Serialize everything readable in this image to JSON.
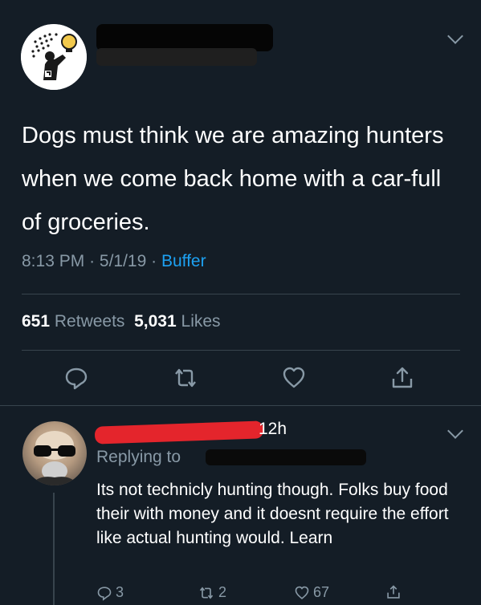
{
  "tweet": {
    "text": "Dogs must think we are amazing hunters when we come back home with a car-full of groceries.",
    "time": "8:13 PM",
    "date": "5/1/19",
    "source": "Buffer",
    "retweets_count": "651",
    "retweets_label": "Retweets",
    "likes_count": "5,031",
    "likes_label": "Likes"
  },
  "reply": {
    "time": "12h",
    "replying_to_label": "Replying to",
    "text": "Its not technicly hunting though. Folks buy food their with money and it doesnt require the effort like actual hunting would. Learn",
    "reply_count": "3",
    "retweet_count": "2",
    "like_count": "67"
  },
  "colors": {
    "background": "#141d26",
    "muted": "#8899a6",
    "accent": "#1da1f2",
    "redaction_red": "#e4252c"
  }
}
